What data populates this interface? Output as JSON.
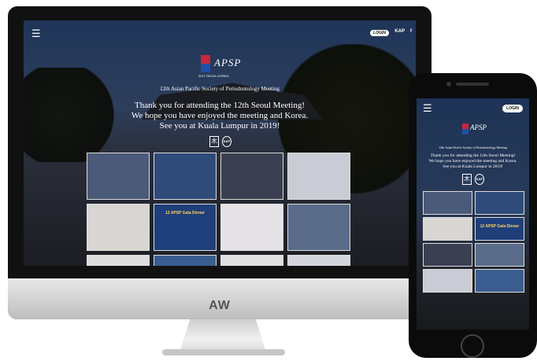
{
  "desktop": {
    "menu_icon": "☰",
    "login_label": "LOGIN",
    "kap_label": "KAP",
    "facebook_label": "f",
    "logo_text": "APSP",
    "logo_year": "2017 SEOUL KOREA",
    "meeting_title": "12th Asian Pacific Society of Periodontology Meeting",
    "thanks_line1": "Thank you for attending the 12th Seoul Meeting!",
    "thanks_line2": "We hope you have enjoyed the meeting and Korea.",
    "thanks_line3": "See you at Kuala Lumpur in 2019!",
    "sponsor1": "木",
    "sponsor2": "KAP",
    "gala_caption": "12 APSP Gala Dinner",
    "photos": [
      {
        "color": "#4a5a78"
      },
      {
        "color": "#2f4b7a"
      },
      {
        "color": "#3b3f52"
      },
      {
        "color": "#c9ccd4"
      },
      {
        "color": "#d8d6d2"
      },
      {
        "color": "#1e3f7a"
      },
      {
        "color": "#e6e3e6"
      },
      {
        "color": "#5a6b8a"
      },
      {
        "color": "#dcdcdc"
      },
      {
        "color": "#3a5d8f"
      },
      {
        "color": "#e0e0e0"
      },
      {
        "color": "#d4d4dc"
      }
    ]
  },
  "monitor_brand": "AW",
  "mobile": {
    "menu_icon": "☰",
    "login_label": "LOGIN",
    "logo_text": "APSP",
    "meeting_title": "12th Asian Pacific Society of Periodontology Meeting",
    "thanks_line1": "Thank you for attending the 12th Seoul Meeting!",
    "thanks_line2": "We hope you have enjoyed the meeting and Korea.",
    "thanks_line3": "See you at Kuala Lumpur in 2019!",
    "sponsor1": "木",
    "sponsor2": "KAP",
    "gala_caption": "12 APSP Gala Dinner",
    "photos": [
      {
        "color": "#4a5a78"
      },
      {
        "color": "#2f4b7a"
      },
      {
        "color": "#d8d6d2"
      },
      {
        "color": "#1e3f7a"
      },
      {
        "color": "#3b3f52"
      },
      {
        "color": "#5a6b8a"
      },
      {
        "color": "#c9ccd4"
      },
      {
        "color": "#3a5d8f"
      }
    ]
  }
}
